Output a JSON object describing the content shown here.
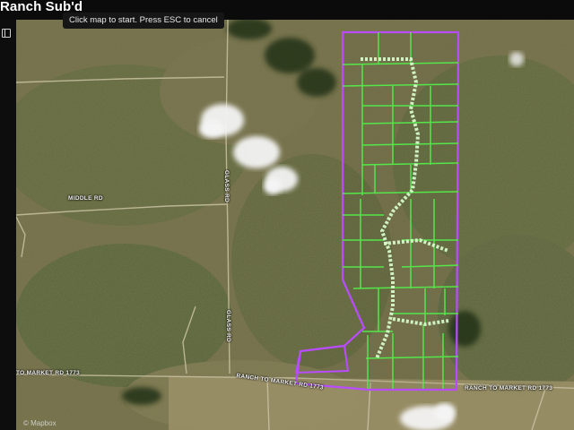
{
  "header": {
    "title": "Ranch Sub'd"
  },
  "hint": {
    "text": "Click map to start. Press ESC to cancel"
  },
  "map": {
    "roads": {
      "middle": "MIDDLE RD",
      "market_west": "TO MARKET RD 1773",
      "ranch_market": "RANCH TO MARKET RD 1773",
      "ranch_east": "RANCH TO MARKET RD 1773",
      "north_vertical": "GLASS RD",
      "south_vertical": "GLASS RD"
    },
    "colors": {
      "boundary": "#b94cff",
      "parcel_lines": "#55e64a",
      "trail": "#d9ffd0"
    }
  },
  "attribution": {
    "text": "© Mapbox"
  }
}
